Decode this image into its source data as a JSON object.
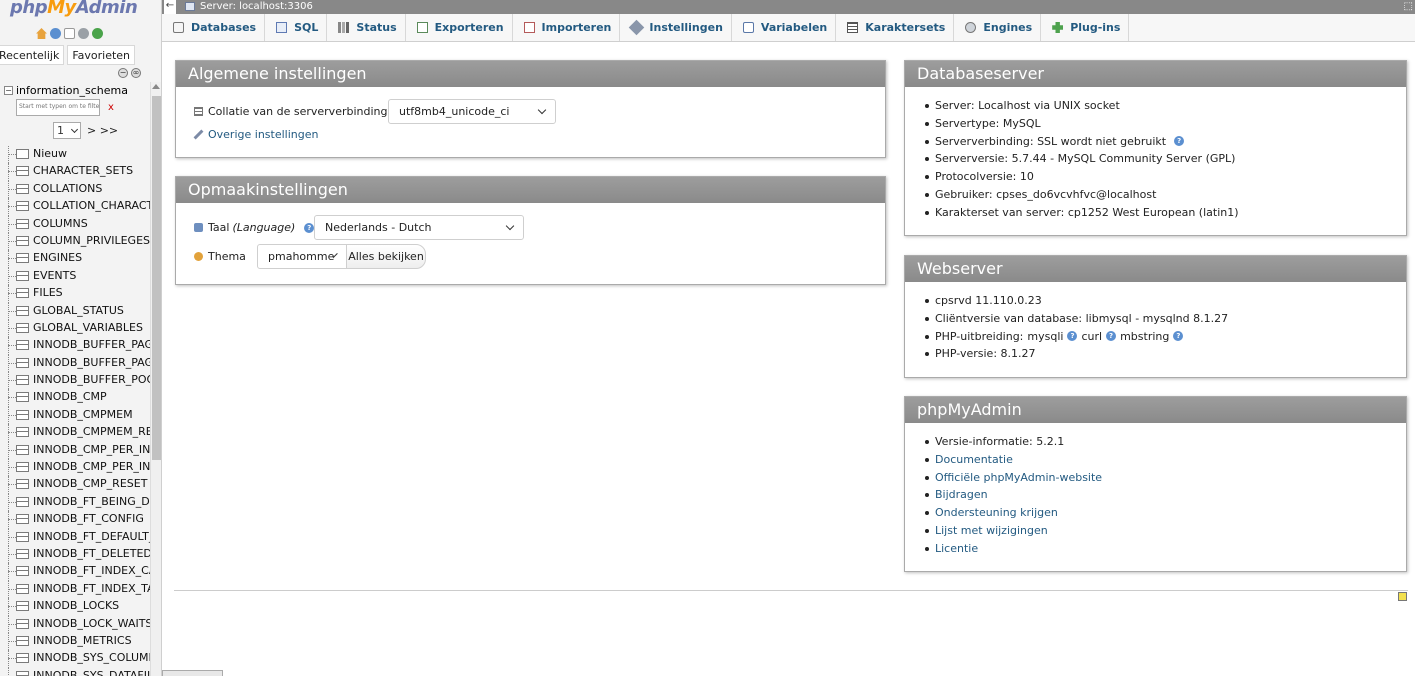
{
  "nav": {
    "logo_php": "php",
    "logo_my": "My",
    "logo_admin": "Admin",
    "tab_recent": "Recentelijk",
    "tab_favorites": "Favorieten",
    "database": "information_schema",
    "filter_placeholder": "Start met typen om te filteren",
    "filter_clear": "x",
    "page_value": "1",
    "page_next": "> >>",
    "new_label": "Nieuw",
    "tables": [
      "CHARACTER_SETS",
      "COLLATIONS",
      "COLLATION_CHARACTER_SET_APPLICABILITY",
      "COLUMNS",
      "COLUMN_PRIVILEGES",
      "ENGINES",
      "EVENTS",
      "FILES",
      "GLOBAL_STATUS",
      "GLOBAL_VARIABLES",
      "INNODB_BUFFER_PAGE",
      "INNODB_BUFFER_PAGE_LRU",
      "INNODB_BUFFER_POOL_STATS",
      "INNODB_CMP",
      "INNODB_CMPMEM",
      "INNODB_CMPMEM_RESET",
      "INNODB_CMP_PER_INDEX",
      "INNODB_CMP_PER_INDEX_RESET",
      "INNODB_CMP_RESET",
      "INNODB_FT_BEING_DELETED",
      "INNODB_FT_CONFIG",
      "INNODB_FT_DEFAULT_STOPWORD",
      "INNODB_FT_DELETED",
      "INNODB_FT_INDEX_CACHE",
      "INNODB_FT_INDEX_TABLE",
      "INNODB_LOCKS",
      "INNODB_LOCK_WAITS",
      "INNODB_METRICS",
      "INNODB_SYS_COLUMNS",
      "INNODB_SYS_DATAFILES"
    ]
  },
  "serverbar": {
    "label": "Server: localhost:3306",
    "back_arrow": "←",
    "maximize": "⬚"
  },
  "menu": {
    "tabs": [
      {
        "label": "Databases",
        "icon": "database-icon"
      },
      {
        "label": "SQL",
        "icon": "sql-icon"
      },
      {
        "label": "Status",
        "icon": "status-icon"
      },
      {
        "label": "Exporteren",
        "icon": "export-icon"
      },
      {
        "label": "Importeren",
        "icon": "import-icon"
      },
      {
        "label": "Instellingen",
        "icon": "settings-icon"
      },
      {
        "label": "Variabelen",
        "icon": "variables-icon"
      },
      {
        "label": "Karaktersets",
        "icon": "charset-icon"
      },
      {
        "label": "Engines",
        "icon": "engines-icon"
      },
      {
        "label": "Plug-ins",
        "icon": "plugins-icon"
      }
    ]
  },
  "general": {
    "title": "Algemene instellingen",
    "collation_label": "Collatie van de serververbinding:",
    "collation_value": "utf8mb4_unicode_ci",
    "more_settings": "Overige instellingen"
  },
  "appearance": {
    "title": "Opmaakinstellingen",
    "language_label": "Taal",
    "language_label_en": "(Language)",
    "language_value": "Nederlands - Dutch",
    "theme_label": "Thema",
    "theme_value": "pmahomme",
    "view_all": "Alles bekijken"
  },
  "dbserver": {
    "title": "Databaseserver",
    "items": [
      "Server: Localhost via UNIX socket",
      "Servertype: MySQL",
      "Serververbinding: SSL wordt niet gebruikt",
      "Serverversie: 5.7.44 - MySQL Community Server (GPL)",
      "Protocolversie: 10",
      "Gebruiker: cpses_do6vcvhfvc@localhost",
      "Karakterset van server: cp1252 West European (latin1)"
    ]
  },
  "webserver": {
    "title": "Webserver",
    "items": [
      "cpsrvd 11.110.0.23",
      "Cliëntversie van database: libmysql - mysqlnd 8.1.27",
      "PHP-versie: 8.1.27"
    ],
    "php_ext_label": "PHP-uitbreiding:",
    "php_ext": [
      "mysqli",
      "curl",
      "mbstring"
    ]
  },
  "pma": {
    "title": "phpMyAdmin",
    "version": "Versie-informatie: 5.2.1",
    "links": [
      "Documentatie",
      "Officiële phpMyAdmin-website",
      "Bijdragen",
      "Ondersteuning krijgen",
      "Lijst met wijzigingen",
      "Licentie"
    ]
  },
  "colors": {
    "link": "#235a81",
    "panel_head": "#8e8e8e",
    "logo_orange": "#f89c0e",
    "logo_blue": "#6c78af"
  }
}
